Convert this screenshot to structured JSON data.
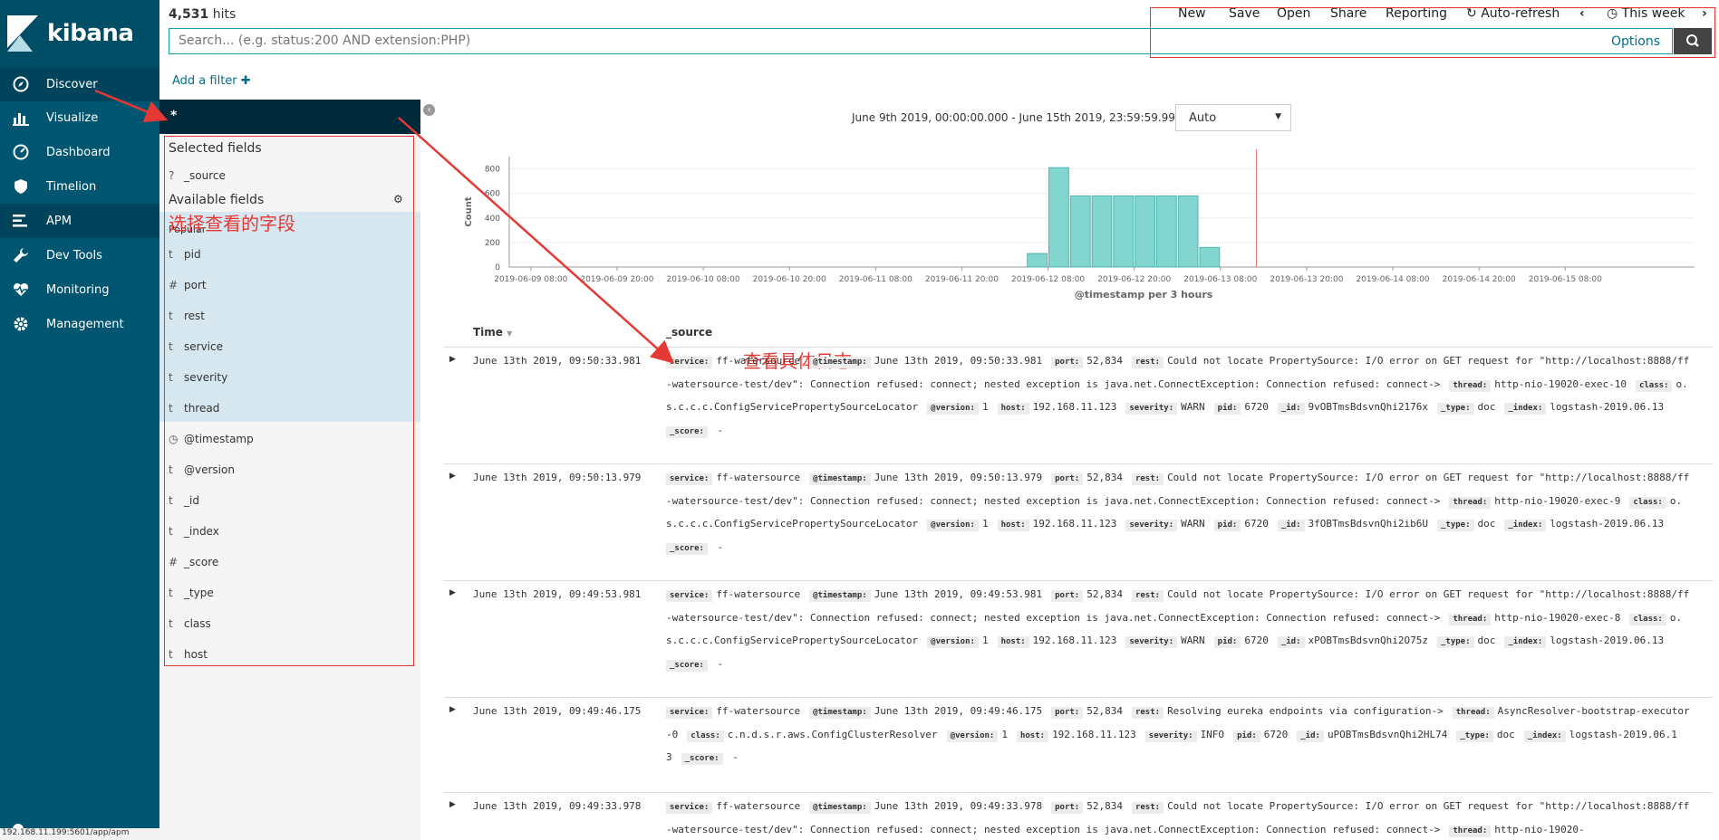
{
  "nav": {
    "brand": "kibana",
    "items": [
      {
        "label": "Discover",
        "icon": "compass-icon"
      },
      {
        "label": "Visualize",
        "icon": "bar-chart-icon"
      },
      {
        "label": "Dashboard",
        "icon": "gauge-icon"
      },
      {
        "label": "Timelion",
        "icon": "shield-icon"
      },
      {
        "label": "APM",
        "icon": "list-icon"
      },
      {
        "label": "Dev Tools",
        "icon": "wrench-icon"
      },
      {
        "label": "Monitoring",
        "icon": "heartbeat-icon"
      },
      {
        "label": "Management",
        "icon": "gear-icon"
      }
    ],
    "status_url": "192.168.11.199:5601/app/apm"
  },
  "header": {
    "hits_count": "4,531",
    "hits_label": "hits",
    "menu": {
      "new": "New",
      "save": "Save",
      "open": "Open",
      "share": "Share",
      "reporting": "Reporting",
      "autorefresh": "Auto-refresh",
      "timerange": "This week"
    },
    "search_placeholder": "Search... (e.g. status:200 AND extension:PHP)",
    "options": "Options",
    "add_filter": "Add a filter"
  },
  "sidebar": {
    "index_pattern": "*",
    "selected_title": "Selected fields",
    "selected_fields": [
      {
        "type": "?",
        "name": "_source"
      }
    ],
    "available_title": "Available fields",
    "popular_title": "Popular",
    "popular_fields": [
      {
        "type": "t",
        "name": "pid"
      },
      {
        "type": "#",
        "name": "port"
      },
      {
        "type": "t",
        "name": "rest"
      },
      {
        "type": "t",
        "name": "service"
      },
      {
        "type": "t",
        "name": "severity"
      },
      {
        "type": "t",
        "name": "thread"
      }
    ],
    "other_fields": [
      {
        "type": "◷",
        "name": "@timestamp"
      },
      {
        "type": "t",
        "name": "@version"
      },
      {
        "type": "t",
        "name": "_id"
      },
      {
        "type": "t",
        "name": "_index"
      },
      {
        "type": "#",
        "name": "_score"
      },
      {
        "type": "t",
        "name": "_type"
      },
      {
        "type": "t",
        "name": "class"
      },
      {
        "type": "t",
        "name": "host"
      }
    ]
  },
  "annotations": {
    "fields": "选择查看的字段",
    "log": "查看具体日志"
  },
  "chart_header": {
    "date_range": "June 9th 2019, 00:00:00.000 - June 15th 2019, 23:59:59.999 —",
    "interval": "Auto"
  },
  "chart_data": {
    "type": "bar",
    "ylabel": "Count",
    "xlabel": "@timestamp per 3 hours",
    "ylim": [
      0,
      900
    ],
    "yticks": [
      0,
      200,
      400,
      600,
      800
    ],
    "xticks": [
      "2019-06-09 08:00",
      "2019-06-09 20:00",
      "2019-06-10 08:00",
      "2019-06-10 20:00",
      "2019-06-11 08:00",
      "2019-06-11 20:00",
      "2019-06-12 08:00",
      "2019-06-12 20:00",
      "2019-06-13 08:00",
      "2019-06-13 20:00",
      "2019-06-14 08:00",
      "2019-06-14 20:00",
      "2019-06-15 08:00"
    ],
    "bars": [
      {
        "x": "2019-06-12 05:00",
        "value": 110
      },
      {
        "x": "2019-06-12 08:00",
        "value": 810
      },
      {
        "x": "2019-06-12 11:00",
        "value": 580
      },
      {
        "x": "2019-06-12 14:00",
        "value": 580
      },
      {
        "x": "2019-06-12 17:00",
        "value": 580
      },
      {
        "x": "2019-06-12 20:00",
        "value": 580
      },
      {
        "x": "2019-06-12 23:00",
        "value": 580
      },
      {
        "x": "2019-06-13 02:00",
        "value": 580
      },
      {
        "x": "2019-06-13 05:00",
        "value": 160
      }
    ],
    "current_time_marker": "2019-06-13 13:00",
    "bar_color": "#83d6d0"
  },
  "table": {
    "col_time": "Time",
    "col_source": "_source",
    "rows": [
      {
        "time": "June 13th 2019, 09:50:33.981",
        "fields": [
          [
            "service:",
            "ff-watersource"
          ],
          [
            "@timestamp:",
            "June 13th 2019, 09:50:33.981"
          ],
          [
            "port:",
            "52,834"
          ],
          [
            "rest:",
            "Could not locate PropertySource: I/O error on GET request for \"http://localhost:8888/ff-watersource-test/dev\": Connection refused: connect; nested exception is java.net.ConnectException: Connection refused: connect->"
          ],
          [
            "thread:",
            "http-nio-19020-exec-10"
          ],
          [
            "class:",
            "o.s.c.c.c.ConfigServicePropertySourceLocator"
          ],
          [
            "@version:",
            "1"
          ],
          [
            "host:",
            "192.168.11.123"
          ],
          [
            "severity:",
            "WARN"
          ],
          [
            "pid:",
            "6720"
          ],
          [
            "_id:",
            "9vOBTmsBdsvnQhi2176x"
          ],
          [
            "_type:",
            "doc"
          ],
          [
            "_index:",
            "logstash-2019.06.13"
          ],
          [
            "_score:",
            " -"
          ]
        ]
      },
      {
        "time": "June 13th 2019, 09:50:13.979",
        "fields": [
          [
            "service:",
            "ff-watersource"
          ],
          [
            "@timestamp:",
            "June 13th 2019, 09:50:13.979"
          ],
          [
            "port:",
            "52,834"
          ],
          [
            "rest:",
            "Could not locate PropertySource: I/O error on GET request for \"http://localhost:8888/ff-watersource-test/dev\": Connection refused: connect; nested exception is java.net.ConnectException: Connection refused: connect->"
          ],
          [
            "thread:",
            "http-nio-19020-exec-9"
          ],
          [
            "class:",
            "o.s.c.c.c.ConfigServicePropertySourceLocator"
          ],
          [
            "@version:",
            "1"
          ],
          [
            "host:",
            "192.168.11.123"
          ],
          [
            "severity:",
            "WARN"
          ],
          [
            "pid:",
            "6720"
          ],
          [
            "_id:",
            "3fOBTmsBdsvnQhi2ib6U"
          ],
          [
            "_type:",
            "doc"
          ],
          [
            "_index:",
            "logstash-2019.06.13"
          ],
          [
            "_score:",
            " -"
          ]
        ]
      },
      {
        "time": "June 13th 2019, 09:49:53.981",
        "fields": [
          [
            "service:",
            "ff-watersource"
          ],
          [
            "@timestamp:",
            "June 13th 2019, 09:49:53.981"
          ],
          [
            "port:",
            "52,834"
          ],
          [
            "rest:",
            "Could not locate PropertySource: I/O error on GET request for \"http://localhost:8888/ff-watersource-test/dev\": Connection refused: connect; nested exception is java.net.ConnectException: Connection refused: connect->"
          ],
          [
            "thread:",
            "http-nio-19020-exec-8"
          ],
          [
            "class:",
            "o.s.c.c.c.ConfigServicePropertySourceLocator"
          ],
          [
            "@version:",
            "1"
          ],
          [
            "host:",
            "192.168.11.123"
          ],
          [
            "severity:",
            "WARN"
          ],
          [
            "pid:",
            "6720"
          ],
          [
            "_id:",
            "xPOBTmsBdsvnQhi2O75z"
          ],
          [
            "_type:",
            "doc"
          ],
          [
            "_index:",
            "logstash-2019.06.13"
          ],
          [
            "_score:",
            " -"
          ]
        ]
      },
      {
        "time": "June 13th 2019, 09:49:46.175",
        "fields": [
          [
            "service:",
            "ff-watersource"
          ],
          [
            "@timestamp:",
            "June 13th 2019, 09:49:46.175"
          ],
          [
            "port:",
            "52,834"
          ],
          [
            "rest:",
            "Resolving eureka endpoints via configuration->"
          ],
          [
            "thread:",
            "AsyncResolver-bootstrap-executor-0"
          ],
          [
            "class:",
            "c.n.d.s.r.aws.ConfigClusterResolver"
          ],
          [
            "@version:",
            "1"
          ],
          [
            "host:",
            "192.168.11.123"
          ],
          [
            "severity:",
            "INFO"
          ],
          [
            "pid:",
            "6720"
          ],
          [
            "_id:",
            "uPOBTmsBdsvnQhi2HL74"
          ],
          [
            "_type:",
            "doc"
          ],
          [
            "_index:",
            "logstash-2019.06.13"
          ],
          [
            "_score:",
            " -"
          ]
        ]
      },
      {
        "time": "June 13th 2019, 09:49:33.978",
        "fields": [
          [
            "service:",
            "ff-watersource"
          ],
          [
            "@timestamp:",
            "June 13th 2019, 09:49:33.978"
          ],
          [
            "port:",
            "52,834"
          ],
          [
            "rest:",
            "Could not locate PropertySource: I/O error on GET request for \"http://localhost:8888/ff-watersource-test/dev\": Connection refused: connect; nested exception is java.net.ConnectException: Connection refused: connect->"
          ],
          [
            "thread:",
            "http-nio-19020-"
          ]
        ]
      }
    ]
  }
}
